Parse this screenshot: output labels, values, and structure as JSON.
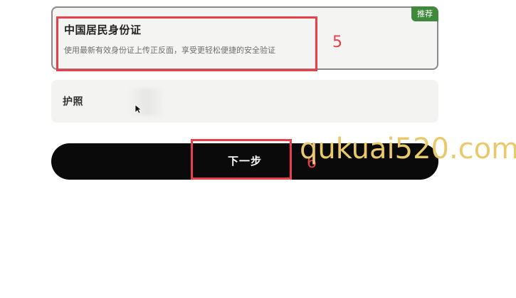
{
  "id_options": {
    "id_card": {
      "title": "中国居民身份证",
      "description": "使用最新有效身份证上传正反面，享受更轻松便捷的安全验证",
      "badge": "推荐"
    },
    "passport": {
      "title": "护照"
    }
  },
  "actions": {
    "next_label": "下一步"
  },
  "annotations": {
    "step_5": "5",
    "step_6": "6",
    "color": "#e8404a"
  },
  "watermark": "qukuai520.com",
  "colors": {
    "badge": "#3f8a3a",
    "primary_button": "#0a0a0a",
    "watermark": "#e9c96b"
  }
}
